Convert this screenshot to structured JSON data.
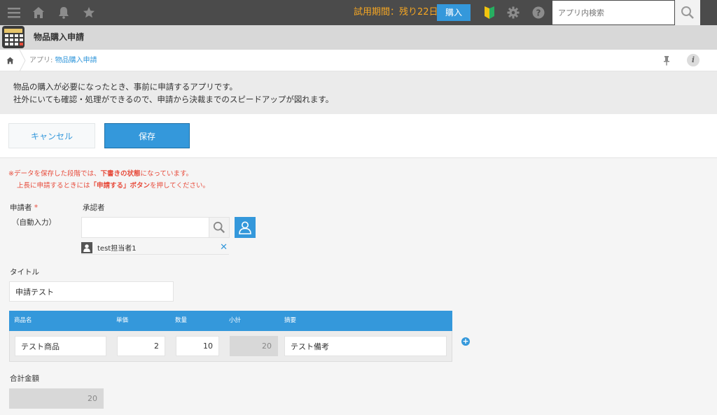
{
  "topbar": {
    "trial_text": "試用期間：残り22日",
    "buy_label": "購入",
    "search_placeholder": "アプリ内検索"
  },
  "app": {
    "title": "物品購入申請"
  },
  "breadcrumb": {
    "prefix": "アプリ:",
    "app_link": "物品購入申請"
  },
  "description": {
    "line1": "物品の購入が必要になったとき、事前に申請するアプリです。",
    "line2": "社外にいても確認・処理ができるので、申請から決裁までのスピードアップが図れます。"
  },
  "actions": {
    "cancel_label": "キャンセル",
    "save_label": "保存"
  },
  "notice": {
    "l1_a": "※データを保存した段階では、",
    "l1_b": "下書きの状態",
    "l1_c": "になっています。",
    "l2_a": "上長に申請するときには",
    "l2_b": "「申請する」ボタン",
    "l2_c": "を押してください。"
  },
  "form": {
    "applicant_label": "申請者",
    "required_mark": "*",
    "applicant_note": "（自動入力）",
    "approver_label": "承認者",
    "approver_value": "",
    "approver_selected": "test担当者1",
    "title_label": "タイトル",
    "title_value": "申請テスト",
    "total_label": "合計金額",
    "total_value": "20"
  },
  "table": {
    "headers": [
      "商品名",
      "単価",
      "数量",
      "小計",
      "摘要"
    ],
    "rows": [
      {
        "name": "テスト商品",
        "price": "2",
        "qty": "10",
        "subtotal": "20",
        "note": "テスト備考"
      }
    ]
  },
  "colors": {
    "topbar": "#4b4b4b",
    "accent": "#3498db",
    "trial": "#f5a623",
    "alert": "#e74c3c"
  },
  "icons": [
    "menu-icon",
    "home-icon",
    "bell-icon",
    "star-icon",
    "beginner-mark-icon",
    "gear-icon",
    "help-icon",
    "search-icon",
    "pin-icon",
    "info-icon",
    "user-icon",
    "close-icon",
    "add-icon"
  ]
}
